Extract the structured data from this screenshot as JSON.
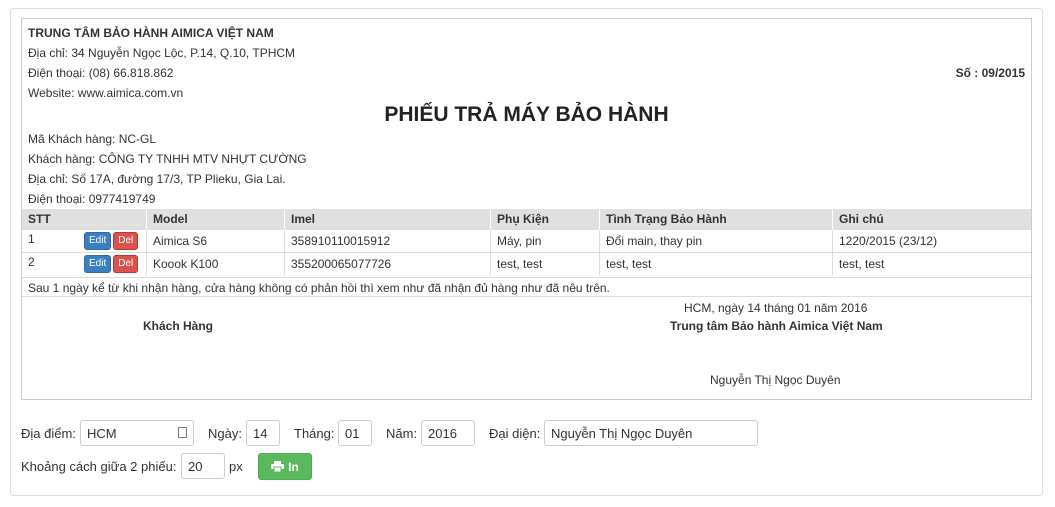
{
  "company": {
    "name": "TRUNG TÂM BẢO HÀNH AIMICA VIỆT NAM",
    "address": "Địa chỉ: 34 Nguyễn Ngọc Lộc, P.14, Q.10, TPHCM",
    "phone": "Điện thoại: (08) 66.818.862",
    "website": "Website: www.aimica.com.vn"
  },
  "doc_number": "Số : 09/2015",
  "title": "PHIẾU TRẢ MÁY BẢO HÀNH",
  "customer": {
    "code": "Mã Khách hàng: NC-GL",
    "name": "Khách hàng: CÔNG TY TNHH MTV NHỰT CƯỜNG",
    "address": "Địa chỉ: Số 17A, đường 17/3, TP Plieku, Gia Lai.",
    "phone": "Điện thoại: 0977419749"
  },
  "table": {
    "headers": [
      "STT",
      "Model",
      "Imel",
      "Phụ Kiện",
      "Tình Trạng Bảo Hành",
      "Ghi chú"
    ],
    "edit_label": "Edit",
    "del_label": "Del",
    "rows": [
      {
        "stt": "1",
        "model": "Aimica S6",
        "imel": "358910110015912",
        "phukien": "Máy, pin",
        "tinhtrang": "Đổi main, thay pin",
        "ghichu": "1220/2015 (23/12)"
      },
      {
        "stt": "2",
        "model": "Koook K100",
        "imel": "355200065077726",
        "phukien": "test, test",
        "tinhtrang": "test, test",
        "ghichu": "test, test"
      }
    ]
  },
  "note": "Sau 1 ngày kể từ khi nhận hàng, cửa hàng không có phản hồi thì xem như đã nhận đủ hàng như đã nêu trên.",
  "signature": {
    "customer_label": "Khách Hàng",
    "date_line": "HCM, ngày 14 tháng 01 năm 2016",
    "center_label": "Trung tâm Bảo hành Aimica Việt Nam",
    "rep_name": "Nguyễn Thị Ngọc Duyên"
  },
  "form": {
    "location_label": "Địa điểm:",
    "location_value": "HCM",
    "day_label": "Ngày:",
    "day_value": "14",
    "month_label": "Tháng:",
    "month_value": "01",
    "year_label": "Năm:",
    "year_value": "2016",
    "rep_label": "Đại diện:",
    "rep_value": "Nguyễn Thị Ngọc Duyên",
    "spacing_label": "Khoảng cách giữa 2 phiếu:",
    "spacing_value": "20",
    "spacing_unit": "px",
    "print_label": "In"
  },
  "colors": {
    "print_button": "#5cb85c",
    "edit_button": "#3a7fc1",
    "del_button": "#d9534f",
    "header_bg": "#e0e0e0"
  }
}
